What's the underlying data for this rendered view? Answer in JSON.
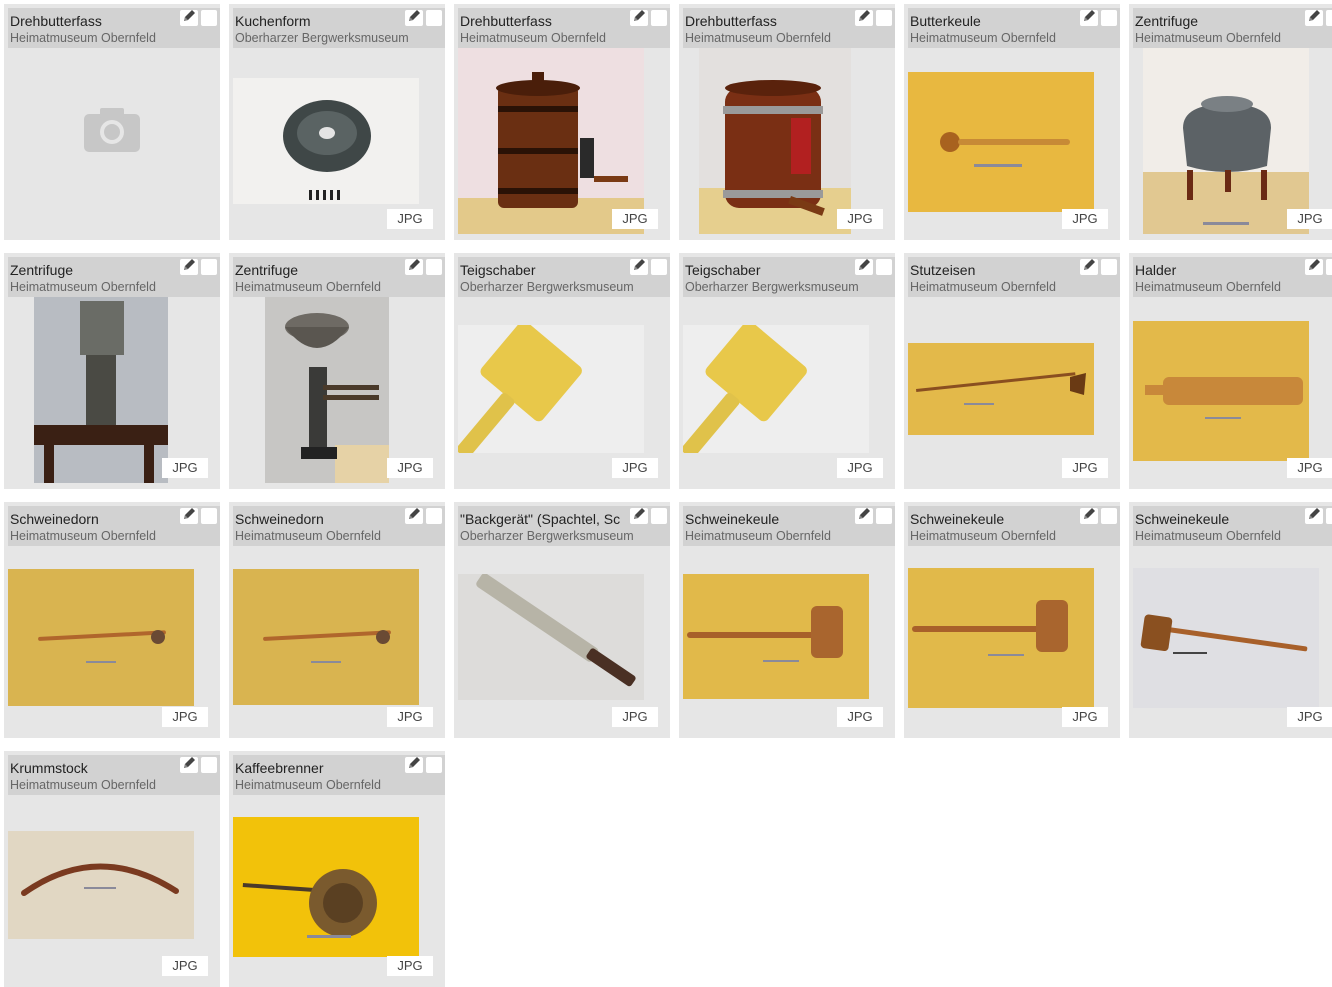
{
  "badge_label": "JPG",
  "cards": [
    {
      "title": "Drehbutterfass",
      "source": "Heimatmuseum Obernfeld",
      "has_image": false,
      "image_icon": "camera-placeholder-icon"
    },
    {
      "title": "Kuchenform",
      "source": "Oberharzer Bergwerksmuseum",
      "has_image": true,
      "image_icon": "cake-mold-photo"
    },
    {
      "title": "Drehbutterfass",
      "source": "Heimatmuseum Obernfeld",
      "has_image": true,
      "image_icon": "butter-churn-photo"
    },
    {
      "title": "Drehbutterfass",
      "source": "Heimatmuseum Obernfeld",
      "has_image": true,
      "image_icon": "butter-barrel-photo"
    },
    {
      "title": "Butterkeule",
      "source": "Heimatmuseum Obernfeld",
      "has_image": true,
      "image_icon": "butter-pestle-photo"
    },
    {
      "title": "Zentrifuge",
      "source": "Heimatmuseum Obernfeld",
      "has_image": true,
      "image_icon": "centrifuge-pot-photo"
    },
    {
      "title": "Zentrifuge",
      "source": "Heimatmuseum Obernfeld",
      "has_image": true,
      "image_icon": "centrifuge-photo"
    },
    {
      "title": "Zentrifuge",
      "source": "Heimatmuseum Obernfeld",
      "has_image": true,
      "image_icon": "centrifuge-bowl-photo"
    },
    {
      "title": "Teigschaber",
      "source": "Oberharzer Bergwerksmuseum",
      "has_image": true,
      "image_icon": "dough-scraper-photo"
    },
    {
      "title": "Teigschaber",
      "source": "Oberharzer Bergwerksmuseum",
      "has_image": true,
      "image_icon": "dough-scraper-photo"
    },
    {
      "title": "Stutzeisen",
      "source": "Heimatmuseum Obernfeld",
      "has_image": true,
      "image_icon": "iron-tool-photo"
    },
    {
      "title": "Halder",
      "source": "Heimatmuseum Obernfeld",
      "has_image": true,
      "image_icon": "wooden-board-photo"
    },
    {
      "title": "Schweinedorn",
      "source": "Heimatmuseum Obernfeld",
      "has_image": true,
      "image_icon": "pig-thorn-photo"
    },
    {
      "title": "Schweinedorn",
      "source": "Heimatmuseum Obernfeld",
      "has_image": true,
      "image_icon": "pig-thorn-photo"
    },
    {
      "title": "\"Backgerät\" (Spachtel, Sc",
      "source": "Oberharzer Bergwerksmuseum",
      "has_image": true,
      "image_icon": "spatula-photo"
    },
    {
      "title": "Schweinekeule",
      "source": "Heimatmuseum Obernfeld",
      "has_image": true,
      "image_icon": "mallet-photo"
    },
    {
      "title": "Schweinekeule",
      "source": "Heimatmuseum Obernfeld",
      "has_image": true,
      "image_icon": "mallet-photo"
    },
    {
      "title": "Schweinekeule",
      "source": "Heimatmuseum Obernfeld",
      "has_image": true,
      "image_icon": "mallet-grey-photo"
    },
    {
      "title": "Krummstock",
      "source": "Heimatmuseum Obernfeld",
      "has_image": true,
      "image_icon": "curved-stick-photo"
    },
    {
      "title": "Kaffeebrenner",
      "source": "Heimatmuseum Obernfeld",
      "has_image": true,
      "image_icon": "coffee-roaster-photo"
    }
  ]
}
